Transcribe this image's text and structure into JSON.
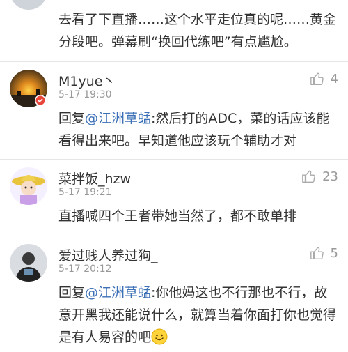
{
  "comments": [
    {
      "text": "去看了下直播……这个水平走位真的呢……黄金分段吧。弹幕刷“换回代练吧”有点尴尬。"
    },
    {
      "username": "M1yue丶",
      "time": "5-17 19:30",
      "likes": "4",
      "reply_prefix": "回复",
      "mention": "@江洲草蜢",
      "text": ":然后打的ADC，菜的话应该能看得出来吧。早知道他应该玩个辅助才对"
    },
    {
      "username": "菜拌饭_hzw",
      "time": "5-17 19:21",
      "likes": "23",
      "text": "直播喊四个王者带她当然了，都不敢单排"
    },
    {
      "username": "爱过贱人养过狗_",
      "time": "5-17 20:12",
      "likes": "5",
      "reply_prefix": "回复",
      "mention": "@江洲草蜢",
      "text": ":你他妈这也不行那也不行，故意开黑我还能说什么，就算当着你面打你也觉得是有人易容的吧"
    }
  ],
  "colors": {
    "mention": "#3b6fb6",
    "meta": "#999999",
    "text": "#333333"
  },
  "icons": [
    "thumbs-up-icon",
    "smile-emoji-icon",
    "level-badge-icon"
  ]
}
